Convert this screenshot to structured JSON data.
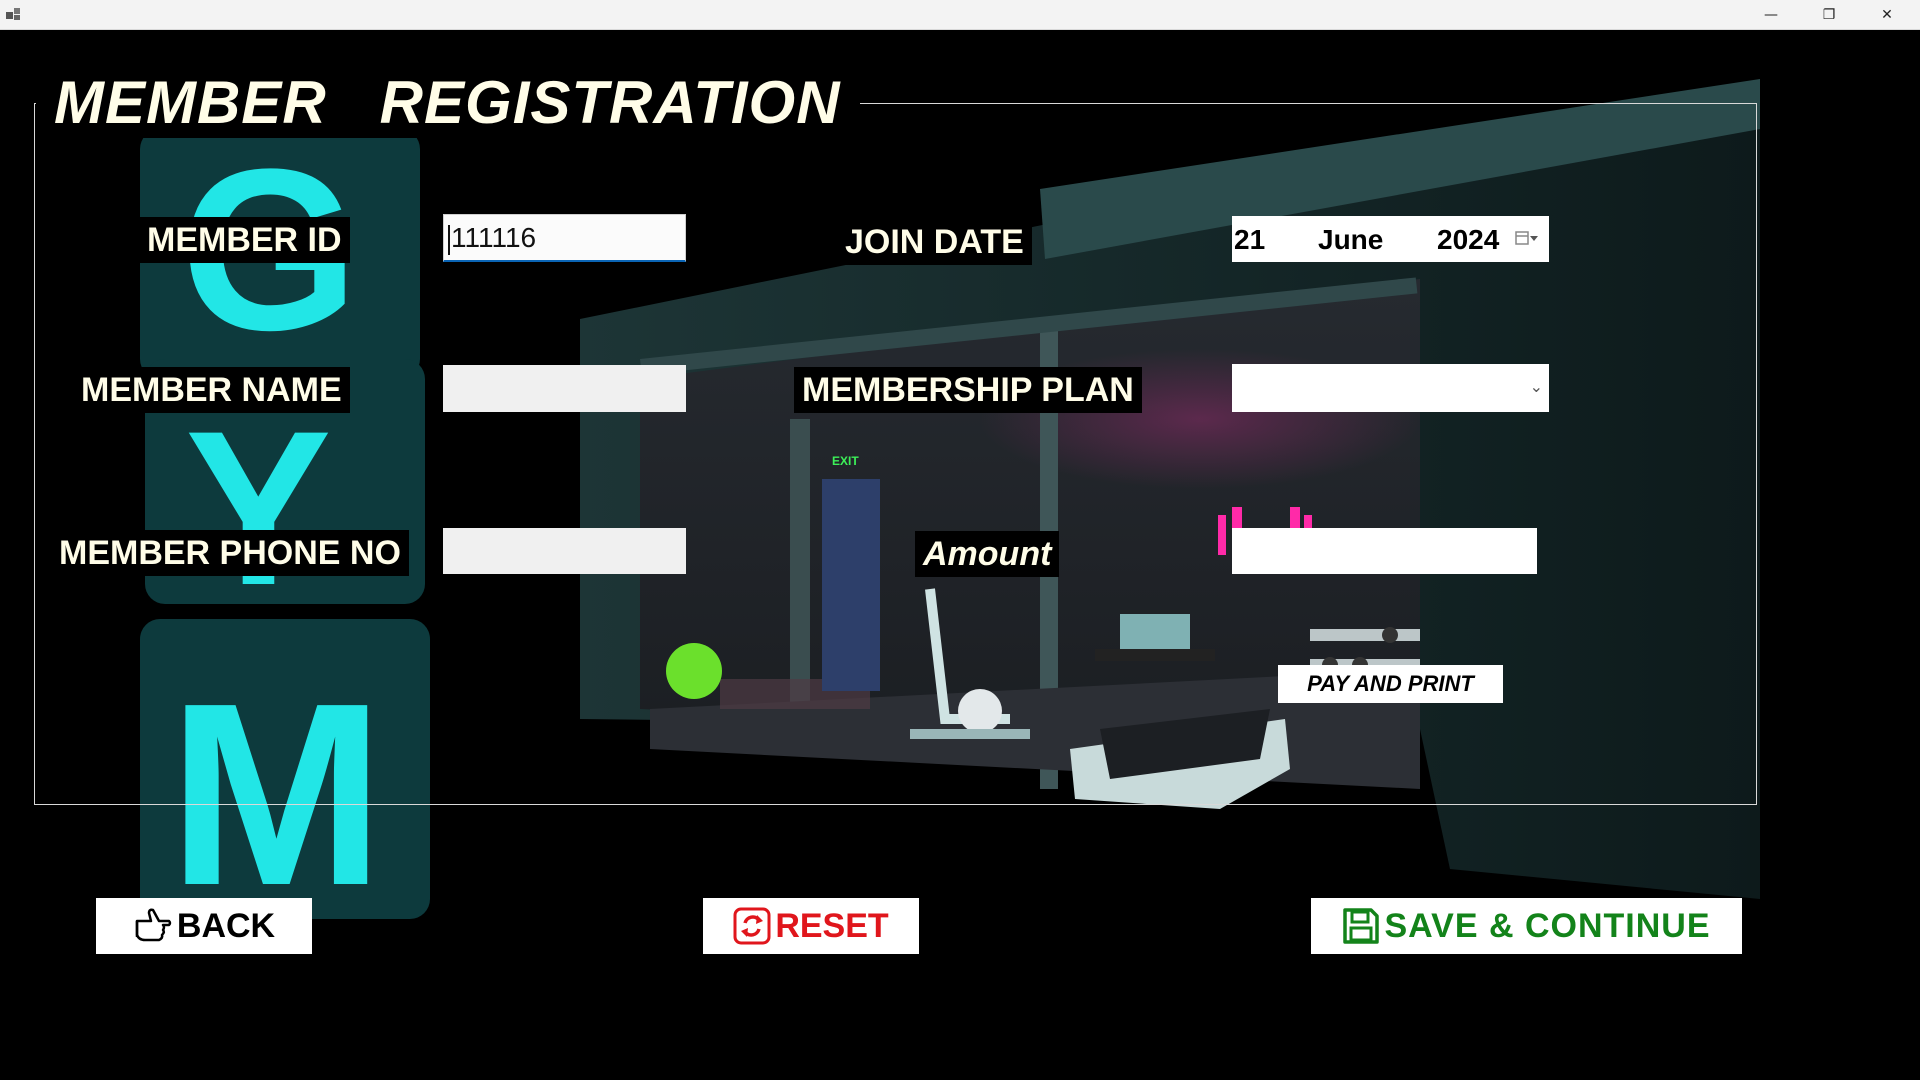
{
  "window": {
    "controls": {
      "minimize": "—",
      "maximize": "❐",
      "close": "✕"
    }
  },
  "form": {
    "title": "MEMBER   REGISTRATION",
    "labels": {
      "member_id": "MEMBER ID",
      "member_name": "MEMBER NAME",
      "member_phone": "MEMBER PHONE NO",
      "join_date": "JOIN DATE",
      "membership_plan": "MEMBERSHIP PLAN",
      "amount": "Amount"
    },
    "fields": {
      "member_id": "111116",
      "member_name": "",
      "member_phone": "",
      "amount": ""
    },
    "join_date": {
      "day": "21",
      "month": "June",
      "year": "2024"
    },
    "membership_plan": {
      "selected": ""
    }
  },
  "buttons": {
    "pay_and_print": "PAY AND PRINT",
    "back": "BACK",
    "reset": "RESET",
    "save_continue": "SAVE & CONTINUE"
  },
  "background": {
    "sign_letters": [
      "G",
      "Y",
      "M"
    ],
    "exit_sign": "EXIT",
    "sign_color": "#22e6e6",
    "accent_color": "#ff2aa8"
  },
  "colors": {
    "label_text": "#fffde8",
    "reset": "#e0161c",
    "save": "#13831a"
  }
}
